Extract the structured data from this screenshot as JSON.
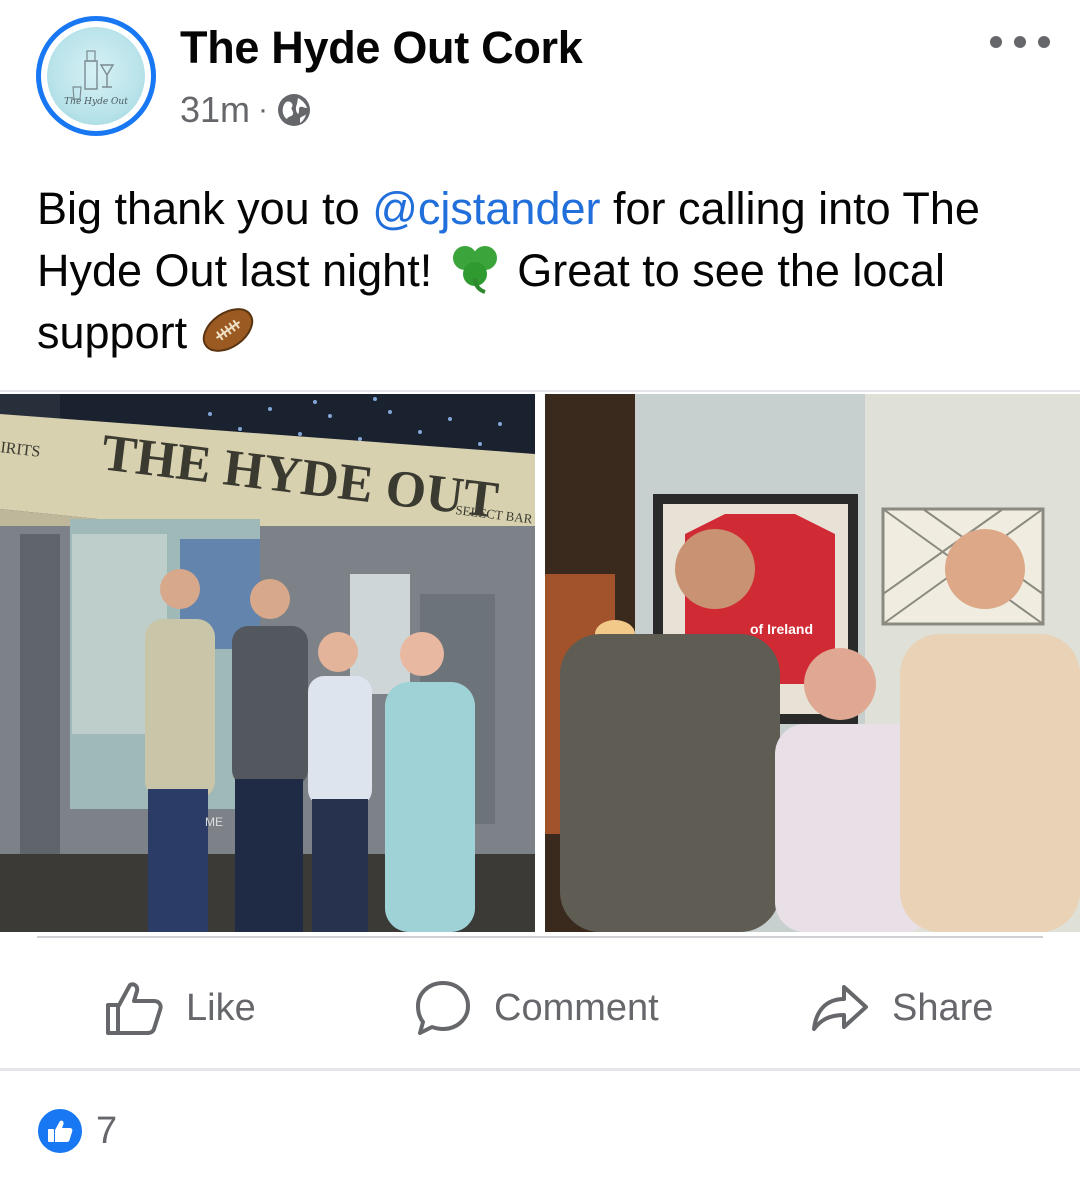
{
  "post": {
    "page_name": "The Hyde Out Cork",
    "time": "31m",
    "separator": "·",
    "visibility_icon": "globe-icon",
    "avatar_text": "The Hyde Out",
    "text_part1": "Big thank you to ",
    "mention": "@cjstander",
    "text_part2": " for calling into The Hyde Out last night! ",
    "text_part3": " Great to see the local support ",
    "emoji_1": "shamrock",
    "emoji_2": "rugby-football"
  },
  "photos": {
    "left": {
      "sign_main": "THE HYDE OUT",
      "sign_side": "SELECT BAR",
      "sign_left": "IRITS",
      "board": "ME"
    },
    "right": {
      "jersey_text": "of Ireland"
    }
  },
  "actions": {
    "like": "Like",
    "comment": "Comment",
    "share": "Share"
  },
  "reactions": {
    "count": "7"
  },
  "colors": {
    "accent": "#1877f2",
    "mention": "#216fdb",
    "secondary_text": "#65676b"
  }
}
